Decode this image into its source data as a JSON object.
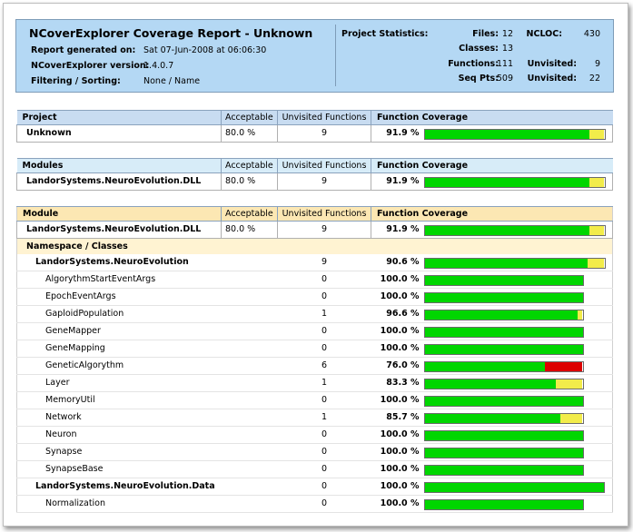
{
  "header": {
    "title": "NCoverExplorer Coverage Report - Unknown",
    "generated_label": "Report generated on:",
    "generated_value": "Sat 07-Jun-2008 at 06:06:30",
    "version_label": "NCoverExplorer version:",
    "version_value": "1.4.0.7",
    "filter_label": "Filtering / Sorting:",
    "filter_value": "None / Name",
    "stats_label": "Project Statistics:",
    "files_label": "Files:",
    "files_value": "12",
    "ncloc_label": "NCLOC:",
    "ncloc_value": "430",
    "classes_label": "Classes:",
    "classes_value": "13",
    "functions_label": "Functions:",
    "functions_value": "111",
    "unvisited_label": "Unvisited:",
    "unvisited_value": "9",
    "seqpts_label": "Seq Pts:",
    "seqpts_value": "509",
    "unvisited2_label": "Unvisited:",
    "unvisited2_value": "22"
  },
  "colors": {
    "covered": "#00d600",
    "partial": "#f2ec4a",
    "low": "#dd0000"
  },
  "columns": {
    "acceptable": "Acceptable",
    "unvisited": "Unvisited Functions",
    "coverage": "Function Coverage"
  },
  "project_table": {
    "heading": "Project",
    "row": {
      "name": "Unknown",
      "acceptable": "80.0 %",
      "unvisited": "9",
      "coverage": "91.9 %",
      "fraction": 0.919
    }
  },
  "modules_table": {
    "heading": "Modules",
    "row": {
      "name": "LandorSystems.NeuroEvolution.DLL",
      "acceptable": "80.0 %",
      "unvisited": "9",
      "coverage": "91.9 %",
      "fraction": 0.919
    }
  },
  "module_table": {
    "heading": "Module",
    "row": {
      "name": "LandorSystems.NeuroEvolution.DLL",
      "acceptable": "80.0 %",
      "unvisited": "9",
      "coverage": "91.9 %",
      "fraction": 0.919
    },
    "ns_heading": "Namespace / Classes",
    "rows": [
      {
        "name": "LandorSystems.NeuroEvolution",
        "level": 1,
        "unvisited": "9",
        "coverage": "90.6 %",
        "fraction": 0.906,
        "bar_scale": 1.0,
        "bar_color": "partial"
      },
      {
        "name": "AlgorythmStartEventArgs",
        "level": 2,
        "unvisited": "0",
        "coverage": "100.0 %",
        "fraction": 1.0,
        "bar_scale": 0.882,
        "bar_color": "partial"
      },
      {
        "name": "EpochEventArgs",
        "level": 2,
        "unvisited": "0",
        "coverage": "100.0 %",
        "fraction": 1.0,
        "bar_scale": 0.882,
        "bar_color": "partial"
      },
      {
        "name": "GaploidPopulation",
        "level": 2,
        "unvisited": "1",
        "coverage": "96.6 %",
        "fraction": 0.966,
        "bar_scale": 0.882,
        "bar_color": "partial"
      },
      {
        "name": "GeneMapper",
        "level": 2,
        "unvisited": "0",
        "coverage": "100.0 %",
        "fraction": 1.0,
        "bar_scale": 0.882,
        "bar_color": "partial"
      },
      {
        "name": "GeneMapping",
        "level": 2,
        "unvisited": "0",
        "coverage": "100.0 %",
        "fraction": 1.0,
        "bar_scale": 0.882,
        "bar_color": "partial"
      },
      {
        "name": "GeneticAlgorythm",
        "level": 2,
        "unvisited": "6",
        "coverage": "76.0 %",
        "fraction": 0.76,
        "bar_scale": 0.882,
        "bar_color": "low"
      },
      {
        "name": "Layer",
        "level": 2,
        "unvisited": "1",
        "coverage": "83.3 %",
        "fraction": 0.833,
        "bar_scale": 0.882,
        "bar_color": "partial"
      },
      {
        "name": "MemoryUtil",
        "level": 2,
        "unvisited": "0",
        "coverage": "100.0 %",
        "fraction": 1.0,
        "bar_scale": 0.882,
        "bar_color": "partial"
      },
      {
        "name": "Network",
        "level": 2,
        "unvisited": "1",
        "coverage": "85.7 %",
        "fraction": 0.857,
        "bar_scale": 0.882,
        "bar_color": "partial"
      },
      {
        "name": "Neuron",
        "level": 2,
        "unvisited": "0",
        "coverage": "100.0 %",
        "fraction": 1.0,
        "bar_scale": 0.882,
        "bar_color": "partial"
      },
      {
        "name": "Synapse",
        "level": 2,
        "unvisited": "0",
        "coverage": "100.0 %",
        "fraction": 1.0,
        "bar_scale": 0.882,
        "bar_color": "partial"
      },
      {
        "name": "SynapseBase",
        "level": 2,
        "unvisited": "0",
        "coverage": "100.0 %",
        "fraction": 1.0,
        "bar_scale": 0.882,
        "bar_color": "partial"
      },
      {
        "name": "LandorSystems.NeuroEvolution.Data",
        "level": 1,
        "unvisited": "0",
        "coverage": "100.0 %",
        "fraction": 1.0,
        "bar_scale": 0.995,
        "bar_color": "partial"
      },
      {
        "name": "Normalization",
        "level": 2,
        "unvisited": "0",
        "coverage": "100.0 %",
        "fraction": 1.0,
        "bar_scale": 0.882,
        "bar_color": "partial"
      }
    ]
  }
}
